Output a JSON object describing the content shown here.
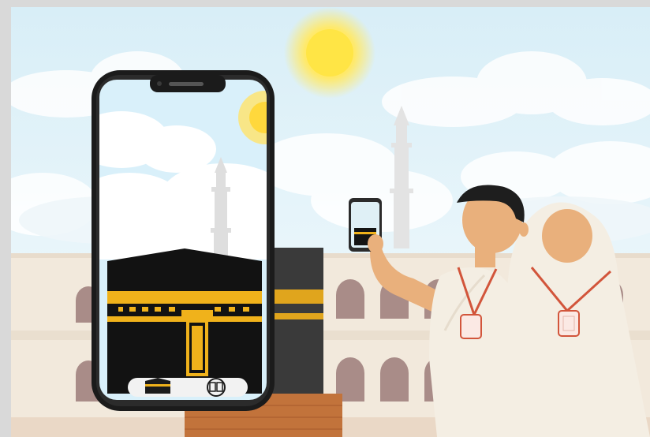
{
  "scene": {
    "description_tag": "illustration",
    "colors": {
      "sky_top": "#dff2f8",
      "sky_bottom": "#f4fbfd",
      "sun": "#ffe44d",
      "kaaba": "#141414",
      "kiswah_band": "#f4b51f",
      "ihram": "#f3ede2",
      "skin": "#e9b07c",
      "hair": "#1e1e1e",
      "lanyard": "#d2553b",
      "phone_frame": "#1b1b1b",
      "building": "#efe4d5",
      "arch": "#a78a86"
    }
  },
  "phone": {
    "toolbar": {
      "left_icon": "kaaba-icon",
      "right_icon": "book-icon"
    }
  }
}
